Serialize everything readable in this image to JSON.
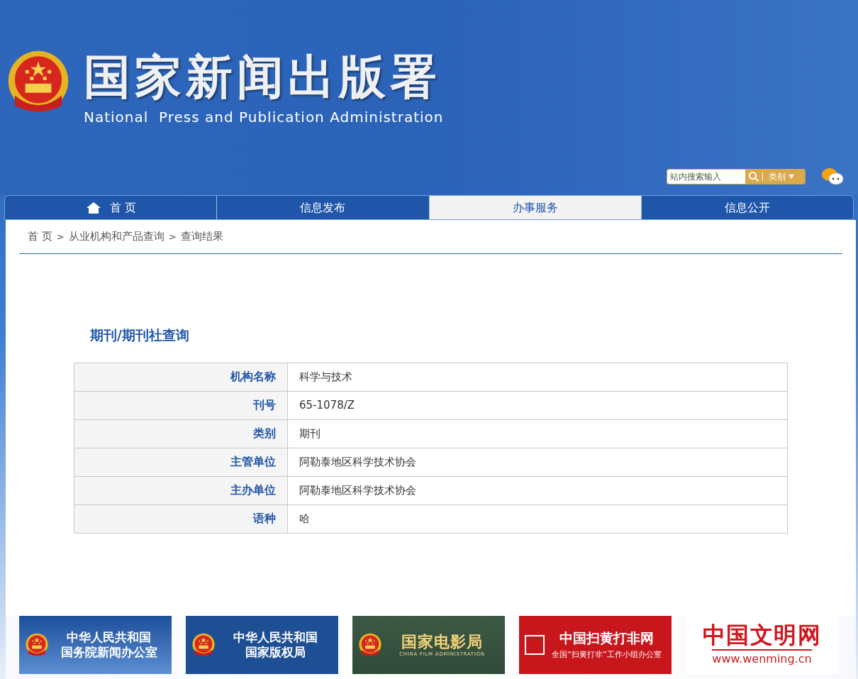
{
  "site": {
    "title": "国家新闻出版署",
    "subtitle": "National  Press and Publication Administration"
  },
  "search": {
    "placeholder": "站内搜索输入",
    "category": "类别"
  },
  "nav": [
    {
      "kind": "home",
      "label": "首 页",
      "selected": false
    },
    {
      "kind": "text",
      "label": "信息发布",
      "selected": false
    },
    {
      "kind": "text",
      "label": "办事服务",
      "selected": true
    },
    {
      "kind": "text",
      "label": "信息公开",
      "selected": false
    }
  ],
  "breadcrumb": [
    {
      "kind": "link",
      "text": "首 页"
    },
    {
      "kind": "separator",
      "text": ">"
    },
    {
      "kind": "link",
      "text": "从业机构和产品查询"
    },
    {
      "kind": "separator",
      "text": ">"
    },
    {
      "kind": "current",
      "text": "查询结果"
    }
  ],
  "heading": "期刊/期刊社查询",
  "table": [
    {
      "label": "机构名称",
      "value": "科学与技术"
    },
    {
      "label": "刊号",
      "value": "65-1078/Z"
    },
    {
      "label": "类别",
      "value": "期刊"
    },
    {
      "label": "主管单位",
      "value": "阿勒泰地区科学技术协会"
    },
    {
      "label": "主办单位",
      "value": "阿勒泰地区科学技术协会"
    },
    {
      "label": "语种",
      "value": "哈"
    }
  ],
  "banners": [
    {
      "kind": "emblem-blue",
      "lines": [
        "中华人民共和国",
        "国务院新闻办公室"
      ]
    },
    {
      "kind": "emblem-navy",
      "lines": [
        "中华人民共和国",
        "国家版权局"
      ]
    },
    {
      "kind": "film",
      "lines": [
        "国家电影局",
        "CHINA FILM ADMINISTRATION"
      ]
    },
    {
      "kind": "red",
      "lines": [
        "中国扫黄打非网",
        "全国“扫黄打非”工作小组办公室"
      ]
    },
    {
      "kind": "plain",
      "lines": [
        "中国文明网",
        "www.wenming.cn"
      ]
    }
  ]
}
